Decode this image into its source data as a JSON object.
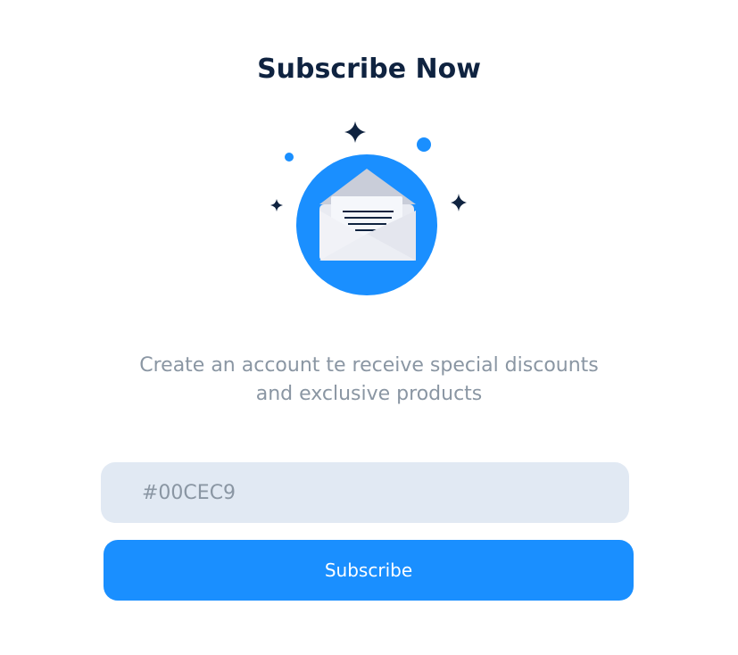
{
  "header": {
    "title": "Subscribe Now"
  },
  "illustration": {
    "icon": "envelope-icon",
    "decorations": [
      "sparkle-icon",
      "sparkle-icon",
      "sparkle-icon",
      "dot-icon",
      "dot-icon"
    ]
  },
  "description": {
    "line1": "Create an account te receive special discounts",
    "line2": "and exclusive products"
  },
  "form": {
    "input_placeholder": "#00CEC9",
    "button_label": "Subscribe"
  },
  "colors": {
    "accent": "#1A8FFF",
    "title": "#0F2340",
    "muted_text": "#8A96A3",
    "input_bg": "#E1E9F3"
  }
}
